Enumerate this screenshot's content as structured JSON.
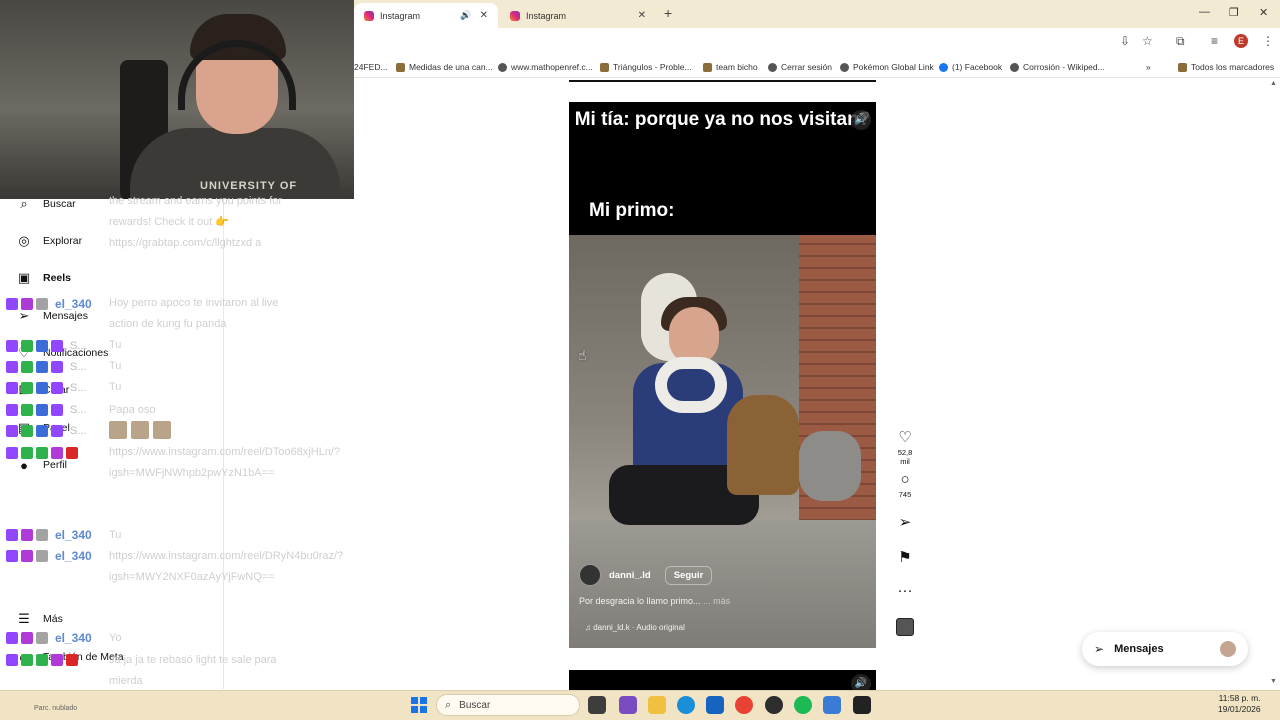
{
  "browser": {
    "tabs": [
      {
        "title": "Instagram",
        "active": true
      },
      {
        "title": "Instagram",
        "active": false
      }
    ],
    "new_tab": "+",
    "window_controls": {
      "minimize": "—",
      "restore": "❐",
      "close": "✕"
    },
    "profile_letter": "E",
    "bookmarks": [
      "24FED...",
      "Medidas de una can...",
      "www.mathopenref.c...",
      "Triángulos - Proble...",
      "team bicho",
      "Cerrar sesión",
      "Pokémon Global Link",
      "(1) Facebook",
      "Corrosión - Wikiped..."
    ],
    "bookmarks_more": "»",
    "all_bookmarks": "Todos los marcadores"
  },
  "webcam": {
    "shirt_text": "UNIVERSITY OF"
  },
  "sidebar": {
    "items": [
      {
        "label": "Buscar",
        "icon": "search-icon"
      },
      {
        "label": "Explorar",
        "icon": "compass-icon"
      },
      {
        "label": "Reels",
        "icon": "reels-icon"
      },
      {
        "label": "Mensajes",
        "icon": "send-icon"
      },
      {
        "label": "Notificaciones",
        "icon": "heart-icon"
      },
      {
        "label": "Crear",
        "icon": "plus-icon"
      },
      {
        "label": "Panel",
        "icon": "dashboard-icon"
      },
      {
        "label": "Perfil",
        "icon": "avatar-icon"
      },
      {
        "label": "Más",
        "icon": "menu-icon"
      },
      {
        "label": "También de Meta",
        "icon": "meta-icon"
      }
    ]
  },
  "chat": {
    "messages": [
      "the stream and earns you points for rewards! Check it out 👉 https://grabtap.com/c/llghtzxd a",
      "Hoy perro apoco te invitaron al live action de kung fu panda",
      "Tu",
      "Tu",
      "Tu",
      "Papa oso",
      "https://www.instagram.com/reel/DToo68xjHLn/?igsh=MWFjNWhpb2pwYzN1bA==",
      "Tu",
      "https://www.instagram.com/reel/DRyN4bu0raz/?igsh=MWY2NXF0azAyYjFwNQ==",
      "Yo",
      "Ja ja ja te rebasó light te sale para mierda"
    ],
    "usernames": [
      "el_340",
      "el_340",
      "el_340",
      "el_340",
      "S..."
    ]
  },
  "reel": {
    "top_text": "Mi tía: porque ya no nos visitan?",
    "primo_text": "Mi primo:",
    "username": "danni_.ld",
    "follow": "Seguir",
    "description": "Por desgracia lo llamo primo...",
    "more": "... más",
    "audio": "danni_ld.k · Audio original",
    "mute_icon": "🔊"
  },
  "actions": {
    "likes": "52,8 mil",
    "comments": "745",
    "more": "···"
  },
  "messages_float": {
    "label": "Mensajes"
  },
  "taskbar": {
    "search": "Buscar",
    "time": "11:58 p. m.",
    "date": "19/01/2026",
    "tray_left": "Parc. nublado"
  },
  "colors": {
    "tabbar": "#f3ead3",
    "taskbar": "#f1e4c4",
    "chat_user": "#5e8ad4",
    "twitch_purple": "#9146ff"
  }
}
